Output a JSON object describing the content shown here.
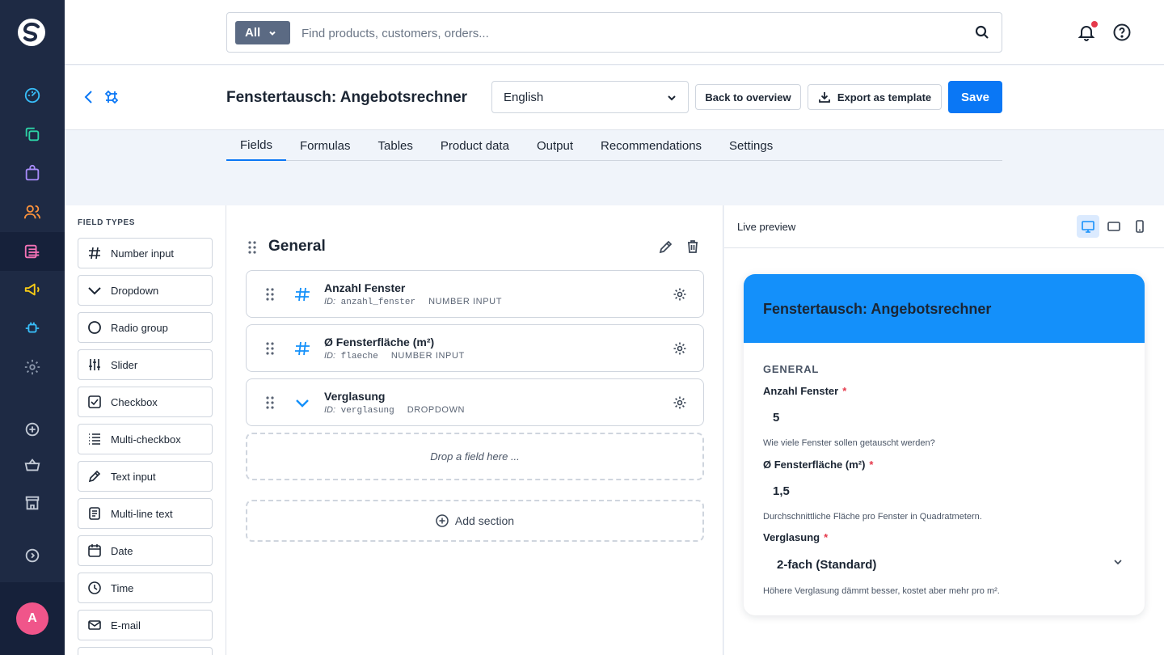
{
  "search": {
    "scope": "All",
    "placeholder": "Find products, customers, orders..."
  },
  "header": {
    "title": "Fenstertausch: Angebotsrechner",
    "language": "English",
    "back_label": "Back to overview",
    "export_label": "Export as template",
    "save_label": "Save"
  },
  "tabs": [
    "Fields",
    "Formulas",
    "Tables",
    "Product data",
    "Output",
    "Recommendations",
    "Settings"
  ],
  "field_types": {
    "label": "FIELD TYPES",
    "items": [
      "Number input",
      "Dropdown",
      "Radio group",
      "Slider",
      "Checkbox",
      "Multi-checkbox",
      "Text input",
      "Multi-line text",
      "Date",
      "Time",
      "E-mail"
    ]
  },
  "canvas": {
    "section_title": "General",
    "fields": [
      {
        "name": "Anzahl Fenster",
        "id_prefix": "ID:",
        "id": "anzahl_fenster",
        "type": "NUMBER INPUT"
      },
      {
        "name": "Ø Fensterfläche (m²)",
        "id_prefix": "ID:",
        "id": "flaeche",
        "type": "NUMBER INPUT"
      },
      {
        "name": "Verglasung",
        "id_prefix": "ID:",
        "id": "verglasung",
        "type": "DROPDOWN"
      }
    ],
    "dropzone": "Drop a field here ...",
    "add_section": "Add section"
  },
  "preview": {
    "label": "Live preview",
    "title": "Fenstertausch: Angebotsrechner",
    "section": "GENERAL",
    "fields": [
      {
        "label": "Anzahl Fenster",
        "required": "*",
        "value": "5",
        "help": "Wie viele Fenster sollen getauscht werden?"
      },
      {
        "label": "Ø Fensterfläche (m²)",
        "required": "*",
        "value": "1,5",
        "help": "Durchschnittliche Fläche pro Fenster in Quadratmetern."
      },
      {
        "label": "Verglasung",
        "required": "*",
        "value": "2-fach (Standard)",
        "help": "Höhere Verglasung dämmt besser, kostet aber mehr pro m²."
      }
    ]
  },
  "user": {
    "avatar_initial": "A"
  },
  "colors": {
    "sidebar": "#1e2a44",
    "primary": "#0a77f5",
    "preview_header": "#1490fa",
    "notification": "#e5394b",
    "avatar": "#f0558a"
  }
}
